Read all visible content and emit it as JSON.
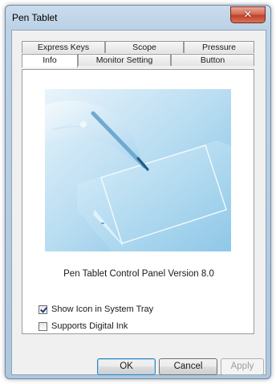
{
  "window": {
    "title": "Pen Tablet",
    "close_label": "✕"
  },
  "tabs": {
    "back_row": [
      {
        "label": "Express Keys"
      },
      {
        "label": "Scope"
      },
      {
        "label": "Pressure"
      }
    ],
    "front_row": [
      {
        "label": "Info",
        "selected": true
      },
      {
        "label": "Monitor Setting"
      },
      {
        "label": "Button"
      }
    ]
  },
  "info": {
    "image": "pen-on-tablet-illustration",
    "version_text": "Pen Tablet Control Panel Version 8.0",
    "checkboxes": [
      {
        "label": "Show Icon in System Tray",
        "checked": true
      },
      {
        "label": "Supports Digital Ink",
        "checked": false
      }
    ]
  },
  "buttons": {
    "ok": "OK",
    "cancel": "Cancel",
    "apply": "Apply",
    "apply_enabled": false
  },
  "colors": {
    "titlebar": "#bcd2e6",
    "close": "#c0412a",
    "tablet_art": "#9ccbe8"
  }
}
